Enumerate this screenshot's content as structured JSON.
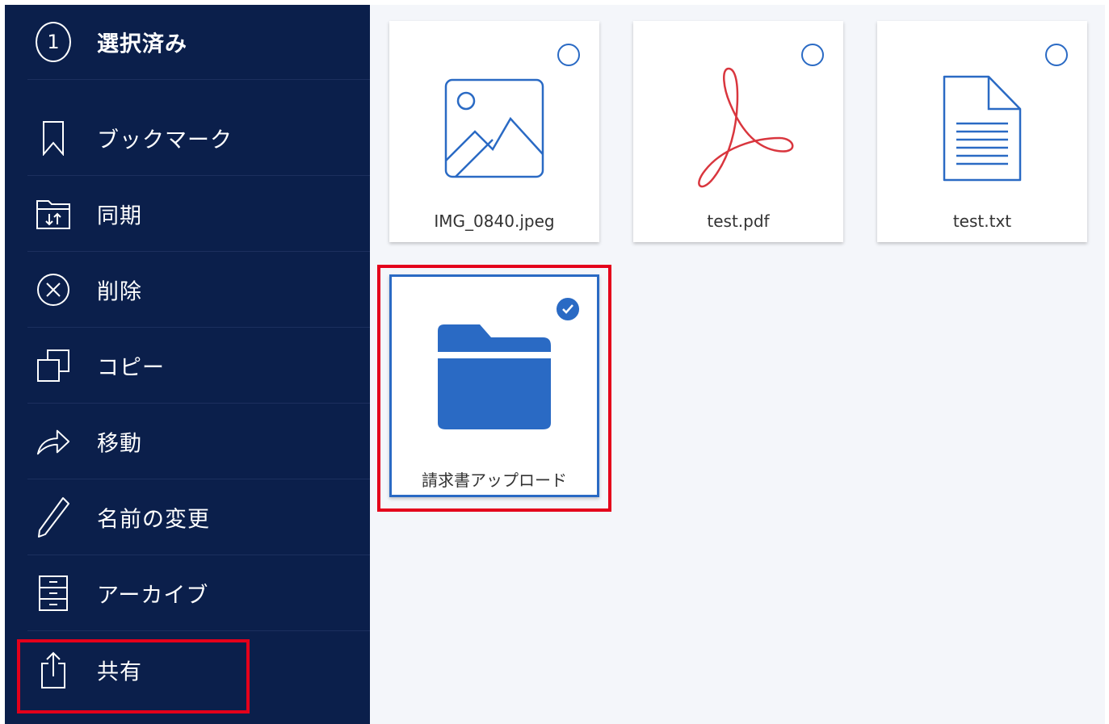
{
  "colors": {
    "sidebar_bg": "#0b1f4b",
    "content_bg": "#f4f6fa",
    "accent_blue": "#2a6ac4",
    "pdf_red": "#d9363e",
    "highlight_red": "#e4001b"
  },
  "sidebar": {
    "header": {
      "count": "1",
      "label": "選択済み"
    },
    "items": [
      {
        "label": "ブックマーク",
        "icon": "bookmark-icon"
      },
      {
        "label": "同期",
        "icon": "sync-folder-icon"
      },
      {
        "label": "削除",
        "icon": "delete-icon"
      },
      {
        "label": "コピー",
        "icon": "copy-icon"
      },
      {
        "label": "移動",
        "icon": "move-icon"
      },
      {
        "label": "名前の変更",
        "icon": "rename-pencil-icon"
      },
      {
        "label": "アーカイブ",
        "icon": "archive-icon"
      },
      {
        "label": "共有",
        "icon": "share-icon"
      }
    ]
  },
  "files": [
    {
      "name": "IMG_0840.jpeg",
      "icon": "image-file-icon",
      "selected": false
    },
    {
      "name": "test.pdf",
      "icon": "pdf-file-icon",
      "selected": false
    },
    {
      "name": "test.txt",
      "icon": "text-file-icon",
      "selected": false
    },
    {
      "name": "請求書アップロード",
      "icon": "folder-icon",
      "selected": true
    }
  ]
}
